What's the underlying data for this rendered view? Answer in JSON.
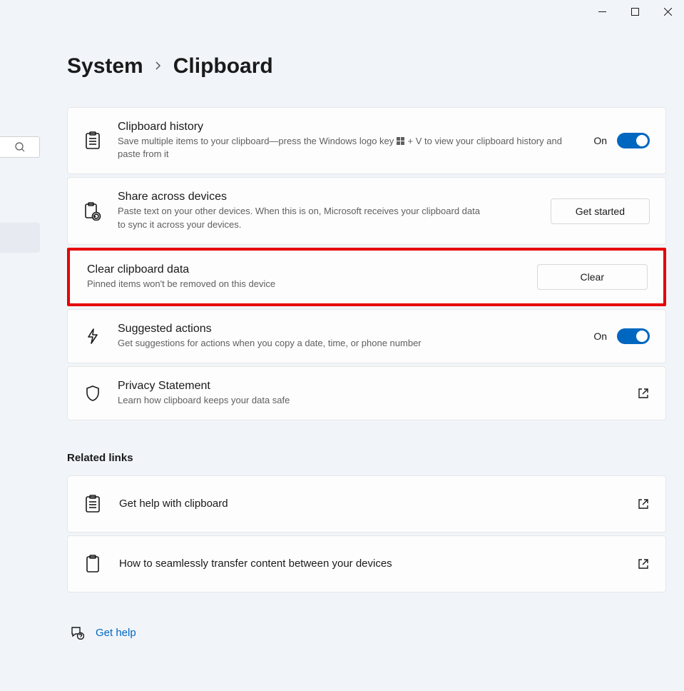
{
  "breadcrumb": {
    "root": "System",
    "page": "Clipboard"
  },
  "cards": {
    "history": {
      "title": "Clipboard history",
      "desc_prefix": "Save multiple items to your clipboard—press the Windows logo key ",
      "desc_suffix": " + V to view your clipboard history and paste from it",
      "toggle_label": "On"
    },
    "share": {
      "title": "Share across devices",
      "desc": "Paste text on your other devices. When this is on, Microsoft receives your clipboard data to sync it across your devices.",
      "button_label": "Get started"
    },
    "clear": {
      "title": "Clear clipboard data",
      "desc": "Pinned items won't be removed on this device",
      "button_label": "Clear"
    },
    "suggested": {
      "title": "Suggested actions",
      "desc": "Get suggestions for actions when you copy a date, time, or phone number",
      "toggle_label": "On"
    },
    "privacy": {
      "title": "Privacy Statement",
      "desc": "Learn how clipboard keeps your data safe"
    }
  },
  "related": {
    "heading": "Related links",
    "help_clipboard": "Get help with clipboard",
    "seamless": "How to seamlessly transfer content between your devices"
  },
  "footer": {
    "get_help": "Get help"
  }
}
